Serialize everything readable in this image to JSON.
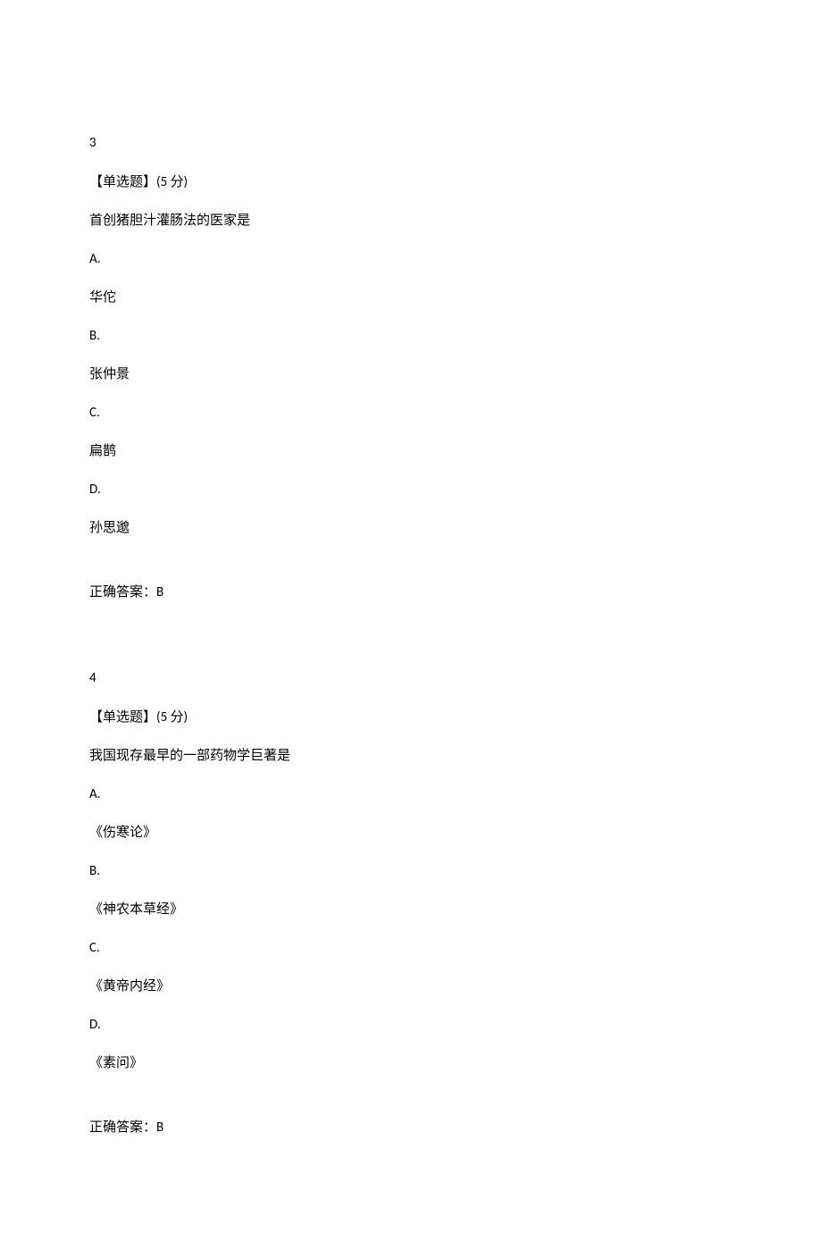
{
  "questions": [
    {
      "number": "3",
      "type": "【单选题】",
      "points": "(5 分)",
      "text": "首创猪胆汁灌肠法的医家是",
      "options": [
        {
          "letter": "A.",
          "text": "华佗"
        },
        {
          "letter": "B.",
          "text": "张仲景"
        },
        {
          "letter": "C.",
          "text": "扁鹊"
        },
        {
          "letter": "D.",
          "text": "孙思邈"
        }
      ],
      "answer_label": "正确答案：",
      "answer_value": "B"
    },
    {
      "number": "4",
      "type": "【单选题】",
      "points": "(5 分)",
      "text": "我国现存最早的一部药物学巨著是",
      "options": [
        {
          "letter": "A.",
          "text": "《伤寒论》"
        },
        {
          "letter": "B.",
          "text": "《神农本草经》"
        },
        {
          "letter": "C.",
          "text": "《黄帝内经》"
        },
        {
          "letter": "D.",
          "text": "《素问》"
        }
      ],
      "answer_label": "正确答案：",
      "answer_value": "B"
    }
  ]
}
